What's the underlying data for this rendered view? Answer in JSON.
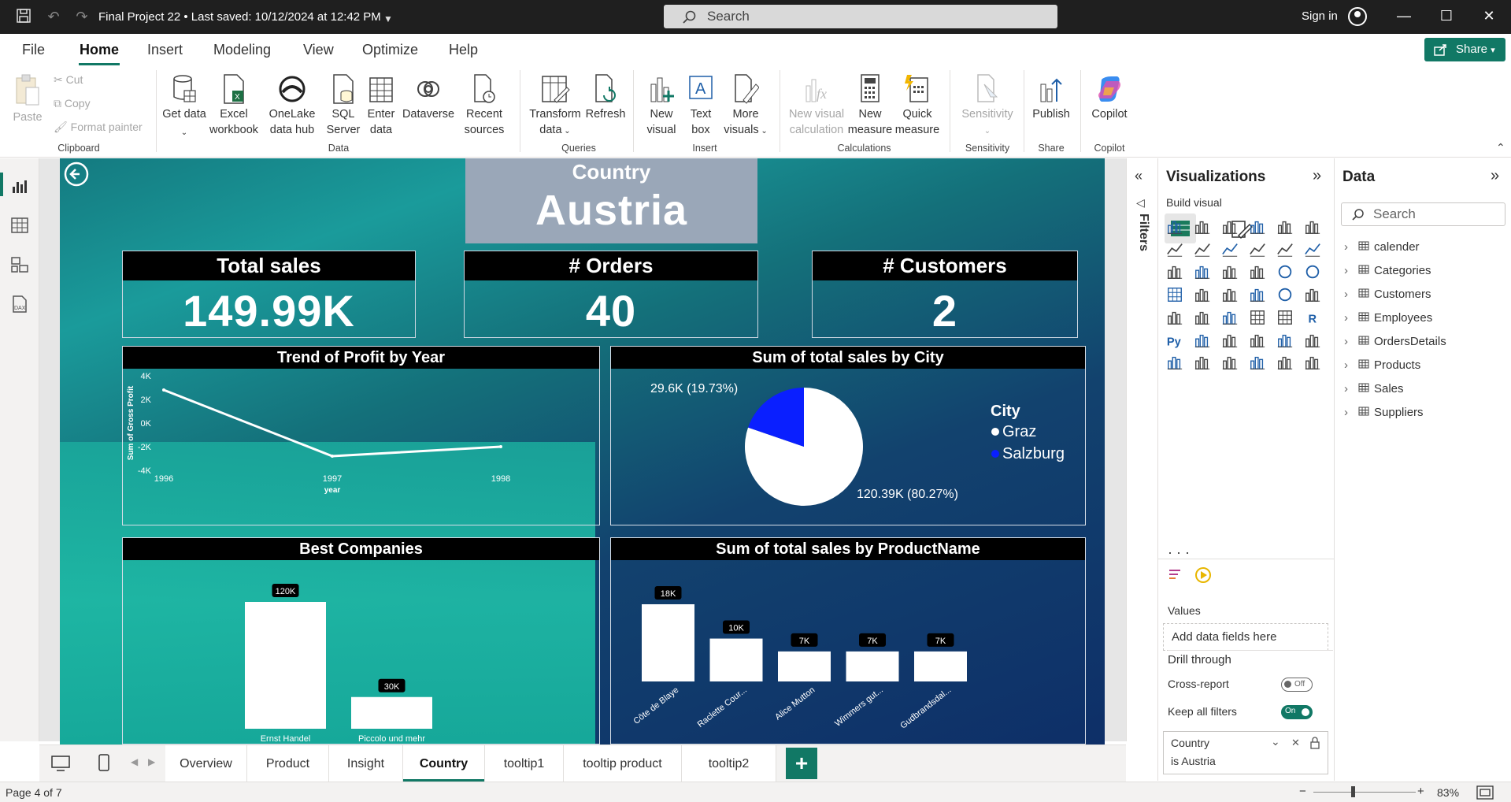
{
  "titlebar": {
    "project": "Final Project 22 • Last saved: 10/12/2024 at 12:42 PM",
    "search_placeholder": "Search",
    "sign_in": "Sign in"
  },
  "menu": {
    "items": [
      "File",
      "Home",
      "Insert",
      "Modeling",
      "View",
      "Optimize",
      "Help"
    ],
    "active": "Home",
    "share": "Share"
  },
  "ribbon": {
    "clipboard": {
      "paste": "Paste",
      "cut": "Cut",
      "copy": "Copy",
      "format_painter": "Format painter",
      "label": "Clipboard"
    },
    "data": {
      "get_data": "Get data",
      "excel": "Excel workbook",
      "onelake": "OneLake data hub",
      "sql": "SQL Server",
      "enter": "Enter data",
      "dataverse": "Dataverse",
      "recent": "Recent sources",
      "label": "Data"
    },
    "queries": {
      "transform": "Transform data",
      "refresh": "Refresh",
      "label": "Queries"
    },
    "insert": {
      "new_visual": "New visual",
      "text_box": "Text box",
      "more_visuals": "More visuals",
      "label": "Insert"
    },
    "calculations": {
      "new_visual_calc": "New visual calculation",
      "new_measure": "New measure",
      "quick_measure": "Quick measure",
      "label": "Calculations"
    },
    "sensitivity": {
      "btn": "Sensitivity",
      "label": "Sensitivity"
    },
    "share": {
      "publish": "Publish",
      "label": "Share"
    },
    "copilot": {
      "btn": "Copilot",
      "label": "Copilot"
    }
  },
  "report": {
    "slicer": {
      "label": "Country",
      "value": "Austria"
    },
    "cards": [
      {
        "title": "Total sales",
        "value": "149.99K"
      },
      {
        "title": "# Orders",
        "value": "40"
      },
      {
        "title": "# Customers",
        "value": "2"
      }
    ],
    "line_title": "Trend of Profit by Year",
    "line_ylabel": "Sum of Gross Profit",
    "line_xlabel": "year",
    "line_yticks": [
      "4K",
      "2K",
      "0K",
      "-2K",
      "-4K"
    ],
    "line_xticks": [
      "1996",
      "1997",
      "1998"
    ],
    "pie_title": "Sum of total sales by City",
    "pie_label_small": "29.6K (19.73%)",
    "pie_label_big": "120.39K (80.27%)",
    "pie_legend_title": "City",
    "pie_legend": [
      "Graz",
      "Salzburg"
    ],
    "companies_title": "Best Companies",
    "companies_labels": [
      "120K",
      "30K"
    ],
    "companies_names": [
      "Ernst Handel",
      "Piccolo und mehr"
    ],
    "products_title": "Sum of total sales by ProductName",
    "products_labels": [
      "18K",
      "10K",
      "7K",
      "7K",
      "7K"
    ],
    "products_names": [
      "Côte de Blaye",
      "Raclette Cour...",
      "Alice Mutton",
      "Wimmers gut...",
      "Gudbrandsdal..."
    ]
  },
  "chart_data": [
    {
      "type": "line",
      "title": "Trend of Profit by Year",
      "xlabel": "year",
      "ylabel": "Sum of Gross Profit",
      "x": [
        1996,
        1997,
        1998
      ],
      "values": [
        2800,
        -2800,
        -2000
      ],
      "ylim": [
        -4000,
        4000
      ]
    },
    {
      "type": "pie",
      "title": "Sum of total sales by City",
      "categories": [
        "Graz",
        "Salzburg"
      ],
      "values": [
        120390,
        29600
      ],
      "colors": [
        "#ffffff",
        "#0a1fff"
      ]
    },
    {
      "type": "bar",
      "title": "Best Companies",
      "categories": [
        "Ernst Handel",
        "Piccolo und mehr"
      ],
      "values": [
        120000,
        30000
      ]
    },
    {
      "type": "bar",
      "title": "Sum of total sales by ProductName",
      "categories": [
        "Côte de Blaye",
        "Raclette Cour...",
        "Alice Mutton",
        "Wimmers gut...",
        "Gudbrandsdal..."
      ],
      "values": [
        18000,
        10000,
        7000,
        7000,
        7000
      ]
    }
  ],
  "pages": {
    "tabs": [
      "Overview",
      "Product",
      "Insight",
      "Country",
      "tooltip1",
      "tooltip product",
      "tooltip2"
    ],
    "active": "Country"
  },
  "status": {
    "page": "Page 4 of 7",
    "zoom": "83%"
  },
  "filters": {
    "label": "Filters"
  },
  "viz": {
    "title": "Visualizations",
    "build": "Build visual",
    "values_label": "Values",
    "values_placeholder": "Add data fields here",
    "drill": "Drill through",
    "cross": "Cross-report",
    "cross_state": "Off",
    "keep": "Keep all filters",
    "keep_state": "On",
    "filter_field": "Country",
    "filter_value": "is Austria"
  },
  "data": {
    "title": "Data",
    "search": "Search",
    "tables": [
      "calender",
      "Categories",
      "Customers",
      "Employees",
      "OrdersDetails",
      "Products",
      "Sales",
      "Suppliers"
    ]
  },
  "colors": {
    "accent": "#117865",
    "salzburg": "#0a1fff"
  }
}
